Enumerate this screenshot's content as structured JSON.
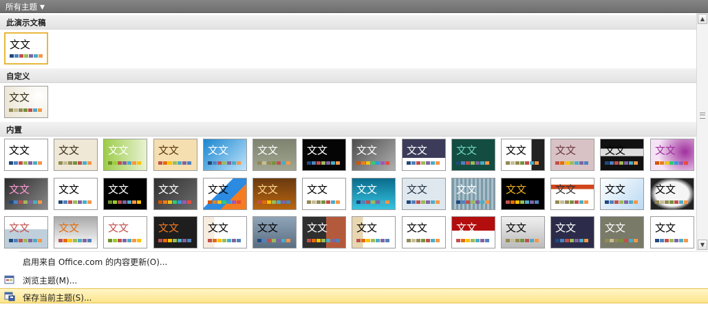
{
  "window": {
    "title": "所有主题",
    "dropdown_icon": "triangle-down-icon"
  },
  "sections": {
    "this_presentation": "此演示文稿",
    "custom": "自定义",
    "builtin": "内置"
  },
  "thumb_text": "文文",
  "swatch_palettes": [
    [
      "#1f497d",
      "#4f81bd",
      "#c0504d",
      "#9bbb59",
      "#8064a2",
      "#4bacc6",
      "#f79646"
    ],
    [
      "#938953",
      "#c4bd97",
      "#948a54",
      "#76923c",
      "#c0504d",
      "#4bacc6",
      "#f79646"
    ],
    [
      "#6b8e23",
      "#9acd32",
      "#c0504d",
      "#8064a2",
      "#4bacc6",
      "#f79646",
      "#ffc000"
    ],
    [
      "#c0504d",
      "#e46c0a",
      "#ffc000",
      "#9bbb59",
      "#4bacc6",
      "#8064a2",
      "#4f81bd"
    ],
    [
      "#d35400",
      "#e67e22",
      "#f1c40f",
      "#2ecc71",
      "#3498db",
      "#9b59b6",
      "#e74c3c"
    ]
  ],
  "menu": {
    "enable_office": "启用来自 Office.com 的内容更新(O)...",
    "browse": "浏览主题(M)...",
    "save": "保存当前主题(S)..."
  },
  "scrollbar": {
    "up_icon": "arrow-up-icon",
    "down_icon": "arrow-down-icon"
  }
}
